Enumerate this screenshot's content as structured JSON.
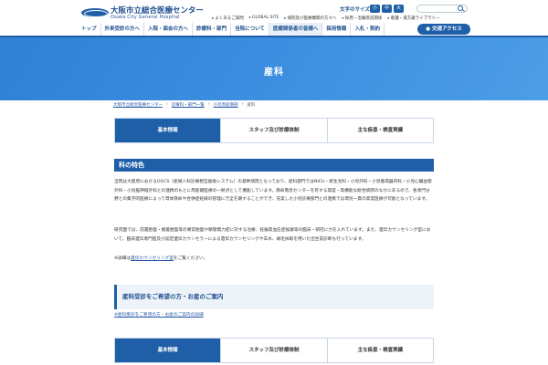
{
  "header": {
    "logo_main": "大阪市立総合医療センター",
    "logo_sub": "Osaka City General Hospital",
    "font_size_label": "文字のサイズ",
    "font_size_options": [
      "小",
      "中",
      "大"
    ],
    "util_links": [
      "よくあるご質問",
      "GLOBAL SITE",
      "病院及び医療機関の方々へ",
      "採用・治験受託関係",
      "看護・漢方薬ライブラリー"
    ]
  },
  "nav": {
    "items": [
      "トップ",
      "外来受診の方へ",
      "入院・面会の方へ",
      "診療科・部門",
      "当院について",
      "医療関係者の皆様へ",
      "採用情報",
      "入札・契約"
    ],
    "access": "交通アクセス"
  },
  "hero": {
    "title": "産科"
  },
  "breadcrumb": {
    "items": [
      "大阪市立総合医療センター",
      "診療科・部門一覧",
      "小児周産期部",
      "産科"
    ]
  },
  "tabs": {
    "labels": [
      "基本情報",
      "スタッフ及び診療体制",
      "主な疾患・検査実績"
    ],
    "active_index": 0
  },
  "section": {
    "heading": "科の特色",
    "para1": "当院は大阪府におけるOGCS（産婦人科診療相互援助システム）の基幹病院となっており、産科部門ではNICU・新生児科・小児外科・小児循環器内科・小児心臓血管外科・小児脳神経外科との連携のもとに周産期医療の一拠点として機能しています。救命救急センターを有する高度・高機能な総合病院のなかにあるので、各専門分野との集学的医療によって母体救命や合併症妊婦の管理に万全を期することができ、充実した小児診療部門との連携では母児一貫の高度医療が可能となっています。",
    "para2": "研究面では、前置胎盤・癒着胎盤等の異常胎盤や頸管無力症に対する治療、妊娠高血圧症候群等の臨床・研究に力を入れています。また、遺伝カウンセリング室において、臨床遺伝専門医及び認定遺伝カウンセラーによる遺伝カウンセリングや羊水、絨毛採取を用いた出生前診断も行っています。",
    "para3_prefix": "※詳細は",
    "para3_link": "遺伝カウンセリング室",
    "para3_suffix": "をご覧ください。"
  },
  "box": {
    "heading": "産科受診をご希望の方・お産のご案内",
    "link": "※産科受診をご希望の方・お産のご案内の詳細"
  }
}
